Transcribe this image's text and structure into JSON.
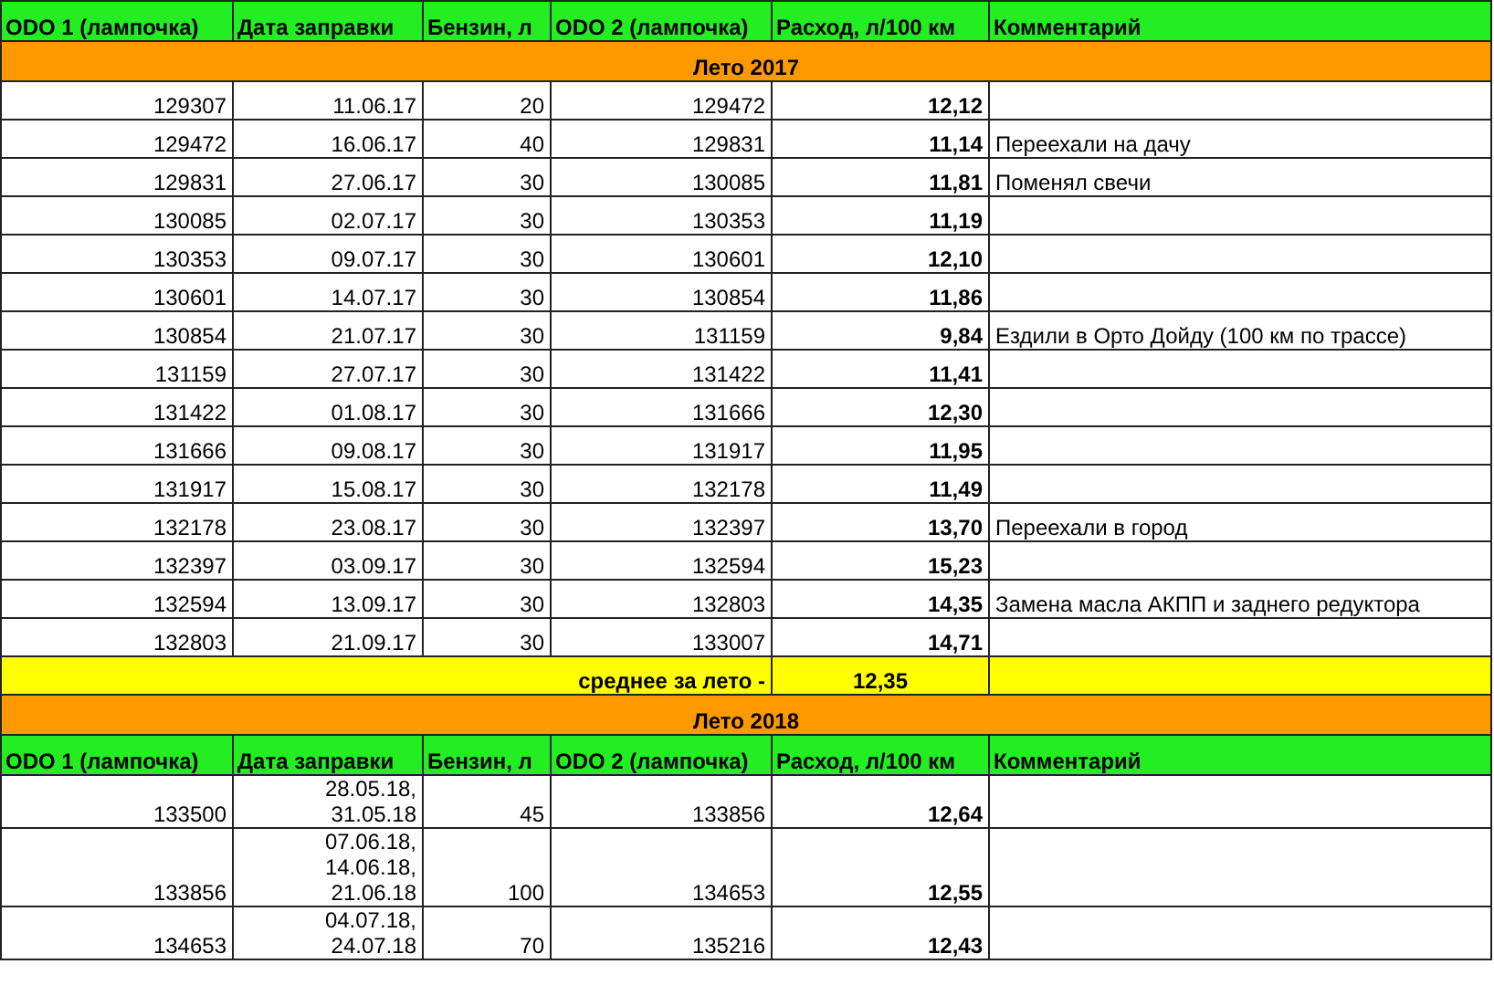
{
  "sections": [
    {
      "title": "Лето 2017",
      "rows": [
        {
          "odo1": "129307",
          "date": "11.06.17",
          "fuel": "20",
          "odo2": "129472",
          "rate": "12,12",
          "comment": ""
        },
        {
          "odo1": "129472",
          "date": "16.06.17",
          "fuel": "40",
          "odo2": "129831",
          "rate": "11,14",
          "comment": "Переехали на дачу"
        },
        {
          "odo1": "129831",
          "date": "27.06.17",
          "fuel": "30",
          "odo2": "130085",
          "rate": "11,81",
          "comment": "Поменял свечи"
        },
        {
          "odo1": "130085",
          "date": "02.07.17",
          "fuel": "30",
          "odo2": "130353",
          "rate": "11,19",
          "comment": ""
        },
        {
          "odo1": "130353",
          "date": "09.07.17",
          "fuel": "30",
          "odo2": "130601",
          "rate": "12,10",
          "comment": ""
        },
        {
          "odo1": "130601",
          "date": "14.07.17",
          "fuel": "30",
          "odo2": "130854",
          "rate": "11,86",
          "comment": ""
        },
        {
          "odo1": "130854",
          "date": "21.07.17",
          "fuel": "30",
          "odo2": "131159",
          "rate": "9,84",
          "comment": "Ездили в Орто Дойду (100 км по трассе)"
        },
        {
          "odo1": "131159",
          "date": "27.07.17",
          "fuel": "30",
          "odo2": "131422",
          "rate": "11,41",
          "comment": ""
        },
        {
          "odo1": "131422",
          "date": "01.08.17",
          "fuel": "30",
          "odo2": "131666",
          "rate": "12,30",
          "comment": ""
        },
        {
          "odo1": "131666",
          "date": "09.08.17",
          "fuel": "30",
          "odo2": "131917",
          "rate": "11,95",
          "comment": ""
        },
        {
          "odo1": "131917",
          "date": "15.08.17",
          "fuel": "30",
          "odo2": "132178",
          "rate": "11,49",
          "comment": ""
        },
        {
          "odo1": "132178",
          "date": "23.08.17",
          "fuel": "30",
          "odo2": "132397",
          "rate": "13,70",
          "comment": "Переехали в город"
        },
        {
          "odo1": "132397",
          "date": "03.09.17",
          "fuel": "30",
          "odo2": "132594",
          "rate": "15,23",
          "comment": ""
        },
        {
          "odo1": "132594",
          "date": "13.09.17",
          "fuel": "30",
          "odo2": "132803",
          "rate": "14,35",
          "comment": "Замена масла АКПП и заднего редуктора"
        },
        {
          "odo1": "132803",
          "date": "21.09.17",
          "fuel": "30",
          "odo2": "133007",
          "rate": "14,71",
          "comment": ""
        }
      ],
      "summary": {
        "label": "среднее за лето -",
        "value": "12,35"
      }
    },
    {
      "title": "Лето 2018",
      "header": [
        "ODO 1 (лампочка)",
        "Дата заправки",
        "Бензин, л",
        "ODO 2 (лампочка)",
        "Расход, л/100 км",
        "Комментарий"
      ],
      "rows": [
        {
          "odo1": "133500",
          "date": "28.05.18, 31.05.18",
          "fuel": "45",
          "odo2": "133856",
          "rate": "12,64",
          "comment": ""
        },
        {
          "odo1": "133856",
          "date": "07.06.18, 14.06.18, 21.06.18",
          "fuel": "100",
          "odo2": "134653",
          "rate": "12,55",
          "comment": ""
        },
        {
          "odo1": "134653",
          "date": "04.07.18, 24.07.18",
          "fuel": "70",
          "odo2": "135216",
          "rate": "12,43",
          "comment": ""
        }
      ]
    }
  ],
  "header": [
    "ODO 1 (лампочка)",
    "Дата заправки",
    "Бензин, л",
    "ODO 2 (лампочка)",
    "Расход, л/100 км",
    "Комментарий"
  ]
}
